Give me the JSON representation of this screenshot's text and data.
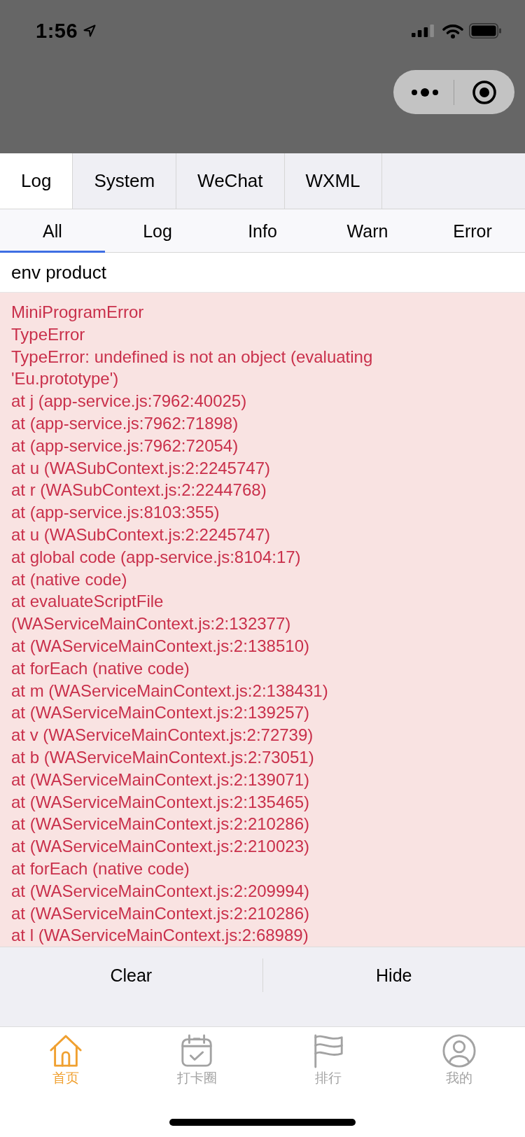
{
  "status_bar": {
    "time": "1:56"
  },
  "tabs": [
    {
      "label": "Log",
      "selected": true
    },
    {
      "label": "System",
      "selected": false
    },
    {
      "label": "WeChat",
      "selected": false
    },
    {
      "label": "WXML",
      "selected": false
    }
  ],
  "filters": [
    {
      "label": "All",
      "selected": true
    },
    {
      "label": "Log",
      "selected": false
    },
    {
      "label": "Info",
      "selected": false
    },
    {
      "label": "Warn",
      "selected": false
    },
    {
      "label": "Error",
      "selected": false
    }
  ],
  "logs": [
    {
      "kind": "log",
      "lines": [
        "env product"
      ]
    },
    {
      "kind": "error",
      "lines": [
        "MiniProgramError",
        "TypeError",
        "TypeError: undefined is not an object (evaluating",
        "'Eu.prototype')",
        "at j (app-service.js:7962:40025)",
        "at (app-service.js:7962:71898)",
        "at (app-service.js:7962:72054)",
        "at u (WASubContext.js:2:2245747)",
        "at r (WASubContext.js:2:2244768)",
        "at (app-service.js:8103:355)",
        "at u (WASubContext.js:2:2245747)",
        "at global code (app-service.js:8104:17)",
        "at (native code)",
        "at evaluateScriptFile",
        "(WAServiceMainContext.js:2:132377)",
        "at (WAServiceMainContext.js:2:138510)",
        "at forEach (native code)",
        "at m (WAServiceMainContext.js:2:138431)",
        "at (WAServiceMainContext.js:2:139257)",
        "at v (WAServiceMainContext.js:2:72739)",
        "at b (WAServiceMainContext.js:2:73051)",
        "at (WAServiceMainContext.js:2:139071)",
        "at (WAServiceMainContext.js:2:135465)",
        "at (WAServiceMainContext.js:2:210286)",
        "at (WAServiceMainContext.js:2:210023)",
        "at forEach (native code)",
        "at (WAServiceMainContext.js:2:209994)",
        "at (WAServiceMainContext.js:2:210286)",
        "at l (WAServiceMainContext.js:2:68989)"
      ]
    }
  ],
  "actions": [
    "Clear",
    "Hide"
  ],
  "tab_bar": [
    {
      "label": "首页",
      "selected": true
    },
    {
      "label": "打卡圈",
      "selected": false
    },
    {
      "label": "排行",
      "selected": false
    },
    {
      "label": "我的",
      "selected": false
    }
  ]
}
